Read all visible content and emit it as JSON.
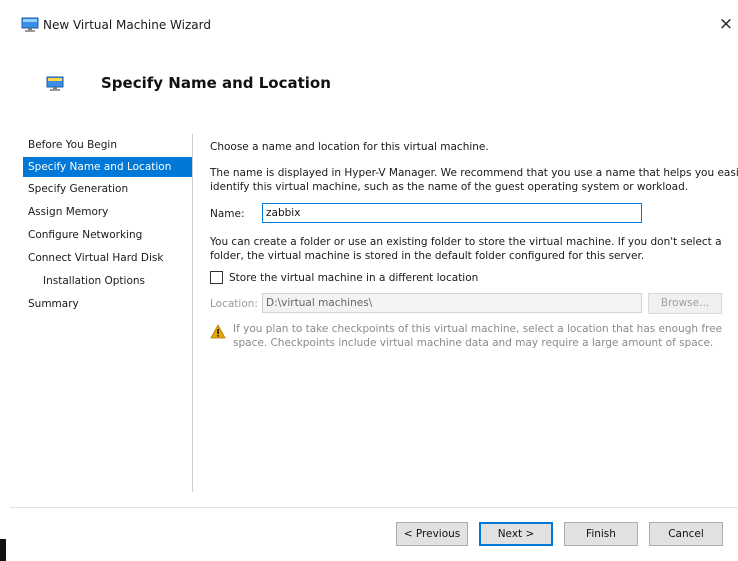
{
  "window": {
    "title": "New Virtual Machine Wizard",
    "close_symbol": "×"
  },
  "header": {
    "title": "Specify Name and Location"
  },
  "nav": {
    "items": [
      {
        "label": "Before You Begin"
      },
      {
        "label": "Specify Name and Location",
        "active": true
      },
      {
        "label": "Specify Generation"
      },
      {
        "label": "Assign Memory"
      },
      {
        "label": "Configure Networking"
      },
      {
        "label": "Connect Virtual Hard Disk"
      },
      {
        "label": "Installation Options"
      },
      {
        "label": "Summary"
      }
    ]
  },
  "content": {
    "intro": "Choose a name and location for this virtual machine.",
    "name_desc_line1": "The name is displayed in Hyper-V Manager. We recommend that you use a name that helps you easily",
    "name_desc_line2": "identify this virtual machine, such as the name of the guest operating system or workload.",
    "name_label": "Name:",
    "name_value": "zabbix",
    "folder_desc_line1": "You can create a folder or use an existing folder to store the virtual machine. If you don't select a",
    "folder_desc_line2": "folder, the virtual machine is stored in the default folder configured for this server.",
    "store_checkbox_label": "Store the virtual machine in a different location",
    "store_checkbox_checked": false,
    "location_label": "Location:",
    "location_value": "D:\\virtual machines\\",
    "browse_label": "Browse...",
    "warning_line1": "If you plan to take checkpoints of this virtual machine, select a location that has enough free",
    "warning_line2": "space. Checkpoints include virtual machine data and may require a large amount of space."
  },
  "buttons": {
    "previous": "< Previous",
    "next": "Next >",
    "finish": "Finish",
    "cancel": "Cancel"
  },
  "colors": {
    "accent": "#0078d7",
    "warning": "#e6a700"
  },
  "icons": {
    "window": "monitor-icon",
    "header": "monitor-icon",
    "warning": "warning-triangle-icon",
    "close": "close-icon"
  }
}
